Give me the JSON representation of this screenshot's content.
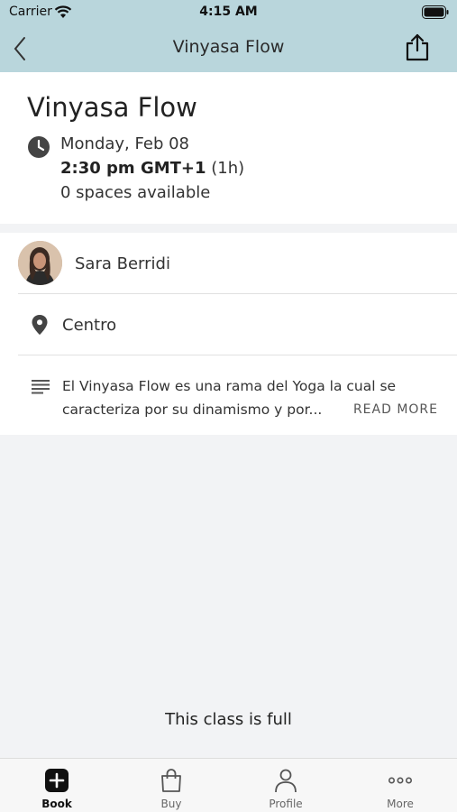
{
  "status_bar": {
    "carrier": "Carrier",
    "time": "4:15 AM"
  },
  "nav": {
    "title": "Vinyasa Flow"
  },
  "class": {
    "title": "Vinyasa Flow",
    "date": "Monday, Feb 08",
    "time": "2:30 pm GMT+1",
    "duration": "(1h)",
    "spaces": "0 spaces available"
  },
  "teacher": {
    "name": "Sara Berridi"
  },
  "location": {
    "name": "Centro"
  },
  "description": {
    "line1": "El Vinyasa Flow es una rama del Yoga la cual se",
    "line2": "caracteriza por su dinamismo y por...",
    "read_more": "READ MORE"
  },
  "full_message": "This class is full",
  "tabs": [
    {
      "label": "Book",
      "icon": "plus-square-icon",
      "active": true
    },
    {
      "label": "Buy",
      "icon": "shopping-bag-icon",
      "active": false
    },
    {
      "label": "Profile",
      "icon": "person-icon",
      "active": false
    },
    {
      "label": "More",
      "icon": "more-dots-icon",
      "active": false
    }
  ],
  "colors": {
    "header_bg": "#b9d6dc",
    "page_bg": "#f2f3f5",
    "card_bg": "#ffffff",
    "text": "#222222"
  }
}
